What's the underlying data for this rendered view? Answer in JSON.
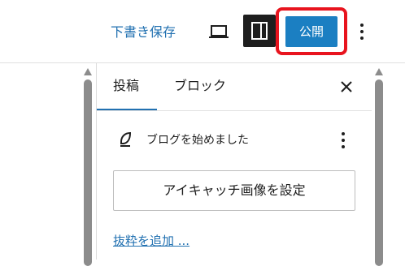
{
  "toolbar": {
    "save_draft_label": "下書き保存",
    "publish_label": "公開",
    "accent_color": "#1b7fc2",
    "highlight_color": "#e8141e",
    "icons": [
      "laptop-icon",
      "sidebar-panel-icon",
      "more-vertical-icon"
    ]
  },
  "sidebar": {
    "tabs": [
      {
        "label": "投稿",
        "active": true
      },
      {
        "label": "ブロック",
        "active": false
      }
    ],
    "close_icon": "close-icon",
    "post": {
      "icon": "feather-icon",
      "title": "ブログを始めました"
    },
    "featured_image_label": "アイキャッチ画像を設定",
    "excerpt_link": "抜粋を追加 ..."
  }
}
